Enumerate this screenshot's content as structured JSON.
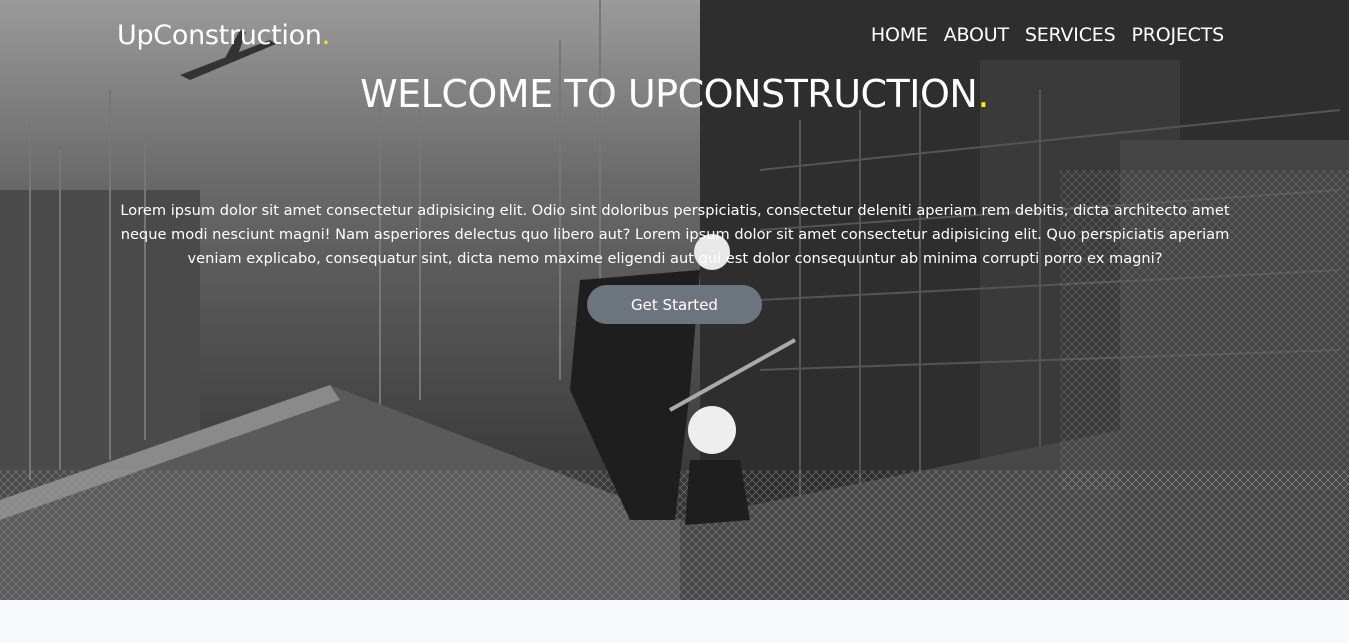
{
  "brand": {
    "name": "UpConstruction",
    "dot": "."
  },
  "nav": {
    "items": [
      {
        "label": "HOME"
      },
      {
        "label": "ABOUT"
      },
      {
        "label": "SERVICES"
      },
      {
        "label": "PROJECTS"
      }
    ]
  },
  "hero": {
    "headline": "WELCOME TO UPCONSTRUCTION",
    "headline_dot": ".",
    "intro": "Lorem ipsum dolor sit amet consectetur adipisicing elit. Odio sint doloribus perspiciatis, consectetur deleniti aperiam rem debitis, dicta architecto amet neque modi nesciunt magni! Nam asperiores delectus quo libero aut? Lorem ipsum dolor sit amet consectetur adipisicing elit. Quo perspiciatis aperiam veniam explicabo, consequatur sint, dicta nemo maxime eligendi aut qui est dolor consequuntur ab minima corrupti porro ex magni?",
    "cta_label": "Get Started"
  },
  "colors": {
    "accent": "#ffee00",
    "button": "#6c757d",
    "text": "#ffffff",
    "page_bg": "#f8f9fa"
  }
}
